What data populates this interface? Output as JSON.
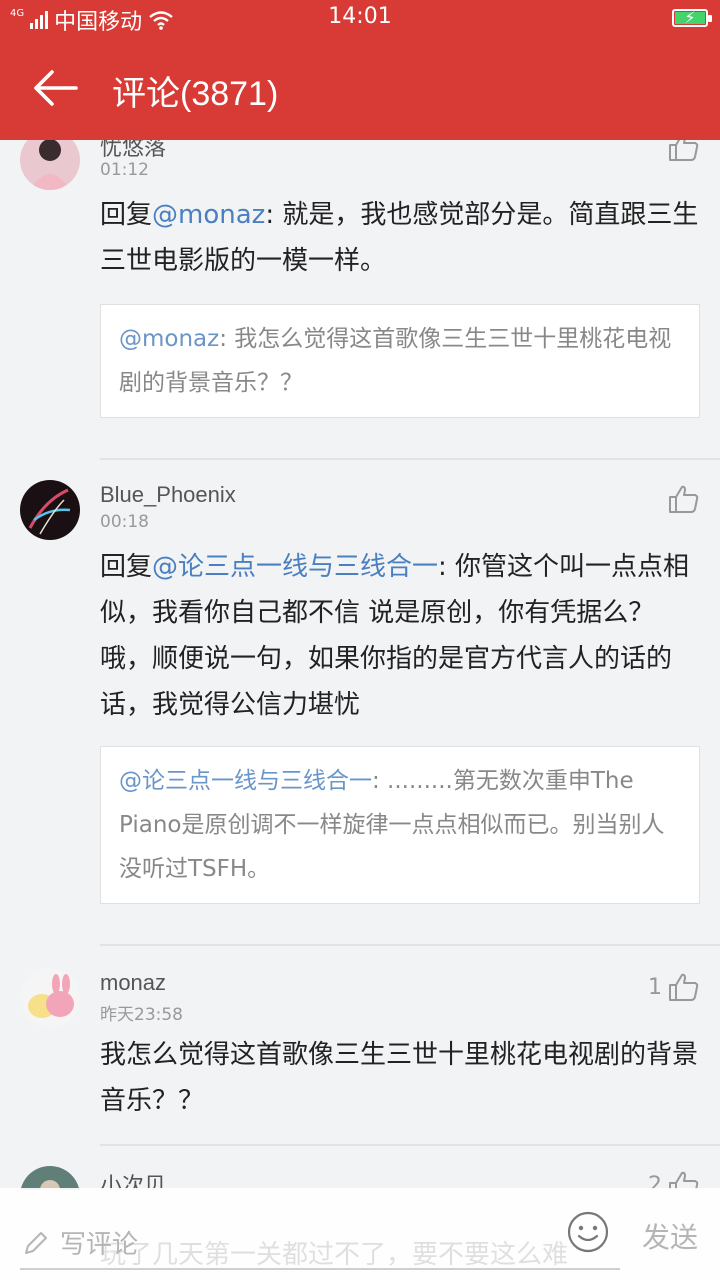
{
  "status_bar": {
    "network": "4G",
    "carrier": "中国移动",
    "time": "14:01"
  },
  "header": {
    "title": "评论(3871)"
  },
  "comments": [
    {
      "username": "忧悠落",
      "time": "01:12",
      "likes": "",
      "reply_prefix": "回复",
      "reply_to": "@monaz",
      "body": ": 就是，我也感觉部分是。简直跟三生三世电影版的一模一样。",
      "quote": {
        "mention": "@monaz",
        "text": ": 我怎么觉得这首歌像三生三世十里桃花电视剧的背景音乐？？"
      }
    },
    {
      "username": "Blue_Phoenix",
      "time": "00:18",
      "likes": "",
      "reply_prefix": "回复",
      "reply_to": "@论三点一线与三线合一",
      "body": ": 你管这个叫一点点相似，我看你自己都不信 说是原创，你有凭据么？哦，顺便说一句，如果你指的是官方代言人的话的话，我觉得公信力堪忧",
      "quote": {
        "mention": "@论三点一线与三线合一",
        "text": ": .........第无数次重申The Piano是原创调不一样旋律一点点相似而已。别当别人没听过TSFH。"
      }
    },
    {
      "username": "monaz",
      "time": "昨天23:58",
      "likes": "1",
      "body": "我怎么觉得这首歌像三生三世十里桃花电视剧的背景音乐？？"
    },
    {
      "username": "小次贝",
      "time": "",
      "likes": "2",
      "body": "玩了几天第一关都过不了，要不要这么难"
    }
  ],
  "bottom_bar": {
    "placeholder": "写评论",
    "send": "发送"
  },
  "colors": {
    "brand": "#d83b35",
    "mention": "#4a7fc1"
  }
}
